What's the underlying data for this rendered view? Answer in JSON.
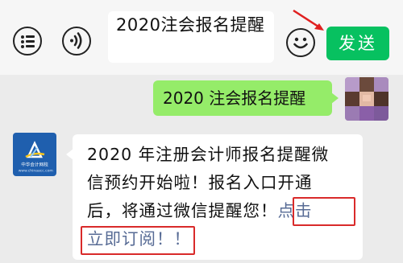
{
  "input_bar": {
    "menu_icon": "list-menu-icon",
    "voice_icon": "voice-icon",
    "input_value": "2020注会报名提醒",
    "emoji_icon": "smiley-icon",
    "send_label": "发送",
    "annotation_arrow_color": "#e02020"
  },
  "chat": {
    "messages": [
      {
        "direction": "outgoing",
        "avatar": "user-avatar-blurred",
        "text": "2020 注会报名提醒"
      },
      {
        "direction": "incoming",
        "avatar": "chinaacc-logo",
        "avatar_brand": "中华会计网校",
        "avatar_url": "www.chinaacc.com",
        "text_lines": [
          "2020 年注册会计师报名提醒微",
          "信预约开始啦！报名入口开通",
          "后，将通过微信提醒您！"
        ],
        "link_part1": "点击",
        "link_part2": "立即订阅！！"
      }
    ]
  },
  "colors": {
    "send_button": "#07c160",
    "outgoing_bubble": "#95ec69",
    "link": "#576b95",
    "highlight_box": "#d92a2a"
  }
}
